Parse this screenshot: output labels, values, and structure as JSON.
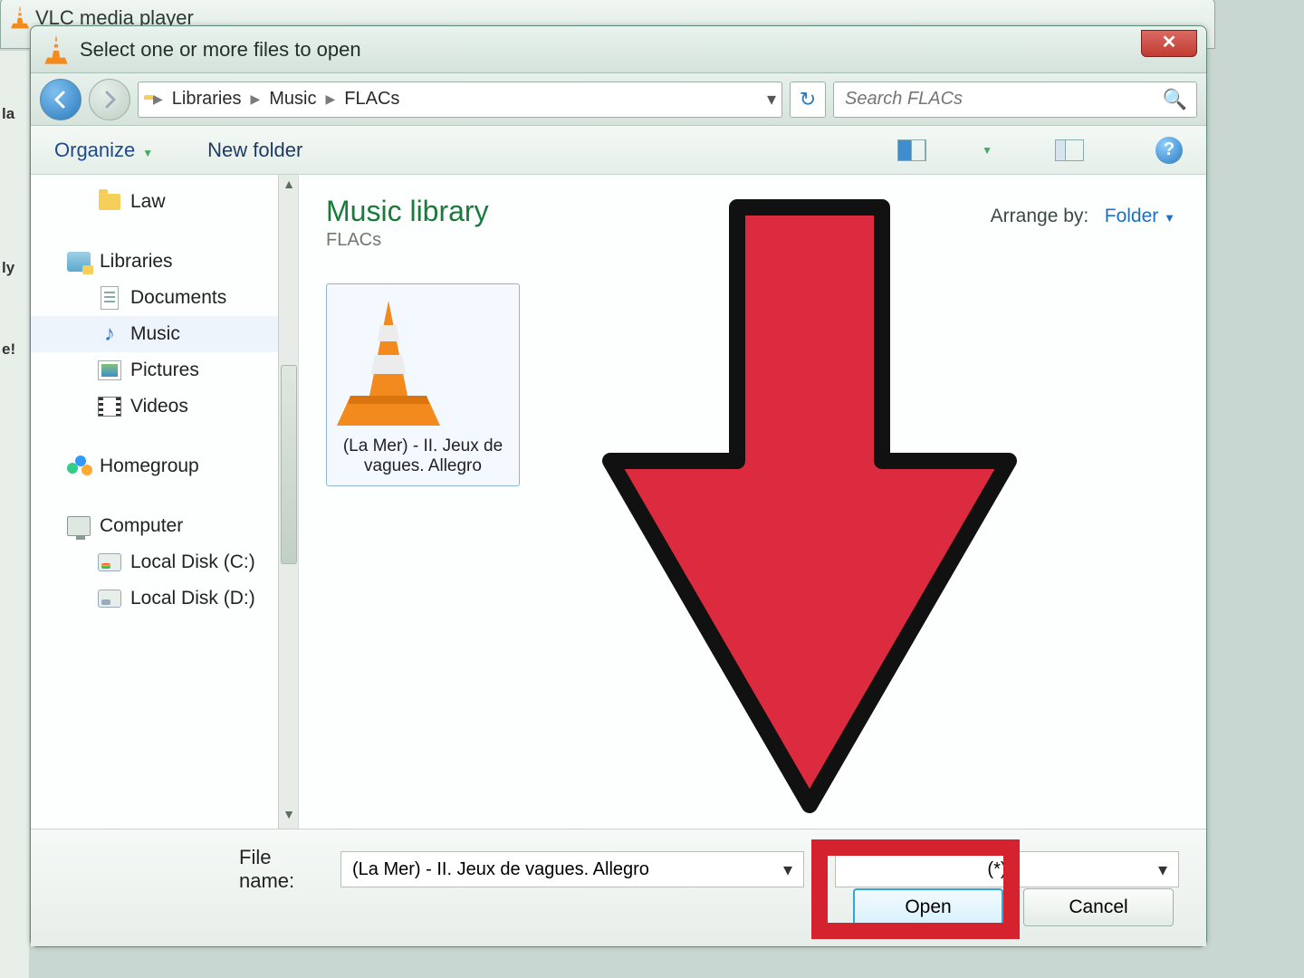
{
  "parent_window": {
    "title": "VLC media player"
  },
  "dialog": {
    "title": "Select one or more files to open",
    "close_glyph": "✕",
    "breadcrumb": [
      "Libraries",
      "Music",
      "FLACs"
    ],
    "search_placeholder": "Search FLACs",
    "toolbar": {
      "organize": "Organize",
      "new_folder": "New folder"
    },
    "tree": {
      "top_item": "Law",
      "libraries": {
        "label": "Libraries",
        "children": [
          "Documents",
          "Music",
          "Pictures",
          "Videos"
        ],
        "selected": "Music"
      },
      "homegroup": "Homegroup",
      "computer": {
        "label": "Computer",
        "children": [
          "Local Disk (C:)",
          "Local Disk (D:)"
        ]
      }
    },
    "content": {
      "heading": "Music library",
      "subheading": "FLACs",
      "arrange_label": "Arrange by:",
      "arrange_value": "Folder",
      "files": [
        {
          "name": "(La Mer) - II. Jeux de vagues. Allegro"
        }
      ]
    },
    "footer": {
      "filename_label": "File name:",
      "filename_value": "(La Mer) - II. Jeux de vagues. Allegro",
      "filter_suffix": "(*)",
      "open": "Open",
      "cancel": "Cancel"
    }
  },
  "annotation": {
    "highlight_target": "open-button"
  }
}
